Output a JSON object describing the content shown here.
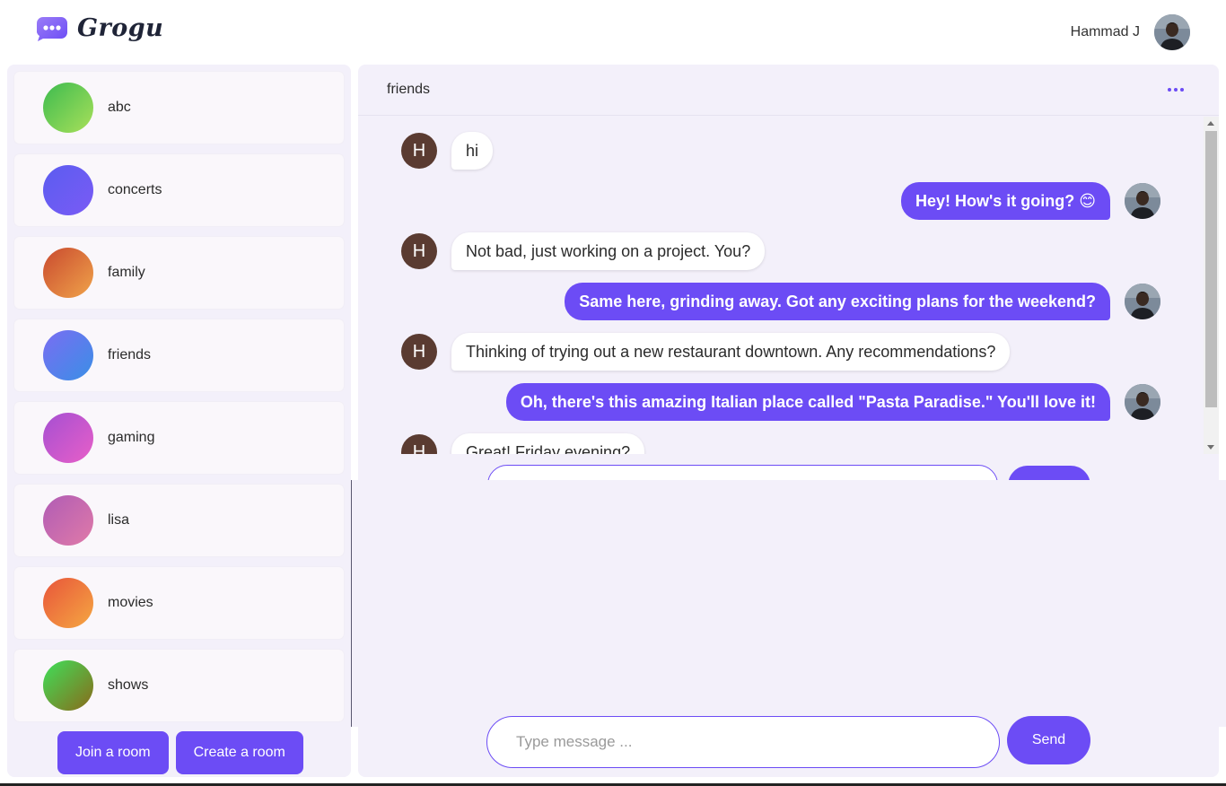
{
  "app": {
    "name": "Grogu"
  },
  "user": {
    "name": "Hammad J"
  },
  "rooms": [
    {
      "name": "abc",
      "gradient": [
        "#3dbb4f",
        "#a9e05a"
      ]
    },
    {
      "name": "concerts",
      "gradient": [
        "#5b5cf0",
        "#7a5bf5"
      ]
    },
    {
      "name": "family",
      "gradient": [
        "#c94a2f",
        "#f0a34a"
      ]
    },
    {
      "name": "friends",
      "gradient": [
        "#7a6df2",
        "#3a8fe6"
      ]
    },
    {
      "name": "gaming",
      "gradient": [
        "#a54fd2",
        "#e85fc8"
      ]
    },
    {
      "name": "lisa",
      "gradient": [
        "#b05cb5",
        "#e07aa8"
      ]
    },
    {
      "name": "movies",
      "gradient": [
        "#e8553a",
        "#f5a742"
      ]
    },
    {
      "name": "shows",
      "gradient": [
        "#3ee05a",
        "#8a6a1a"
      ]
    }
  ],
  "sidebar_actions": {
    "join": "Join a room",
    "create": "Create a room"
  },
  "chat": {
    "title": "friends",
    "messages": [
      {
        "from": "other",
        "initial": "H",
        "text": "hi"
      },
      {
        "from": "me",
        "text": "Hey! How's it going? 😊"
      },
      {
        "from": "other",
        "initial": "H",
        "text": "Not bad, just working on a project. You?"
      },
      {
        "from": "me",
        "text": "Same here, grinding away. Got any exciting plans for the weekend?"
      },
      {
        "from": "other",
        "initial": "H",
        "text": "Thinking of trying out a new restaurant downtown. Any recommendations?"
      },
      {
        "from": "me",
        "text": "Oh, there's this amazing Italian place called \"Pasta Paradise.\" You'll love it!"
      },
      {
        "from": "other",
        "initial": "H",
        "text": "Great! Friday evening?"
      }
    ]
  },
  "composer": {
    "placeholder": "Type message ...",
    "send_label": "Send"
  },
  "colors": {
    "accent": "#6c4cf5",
    "panel": "#f3f0fa",
    "other_avatar": "#5a3b31"
  }
}
